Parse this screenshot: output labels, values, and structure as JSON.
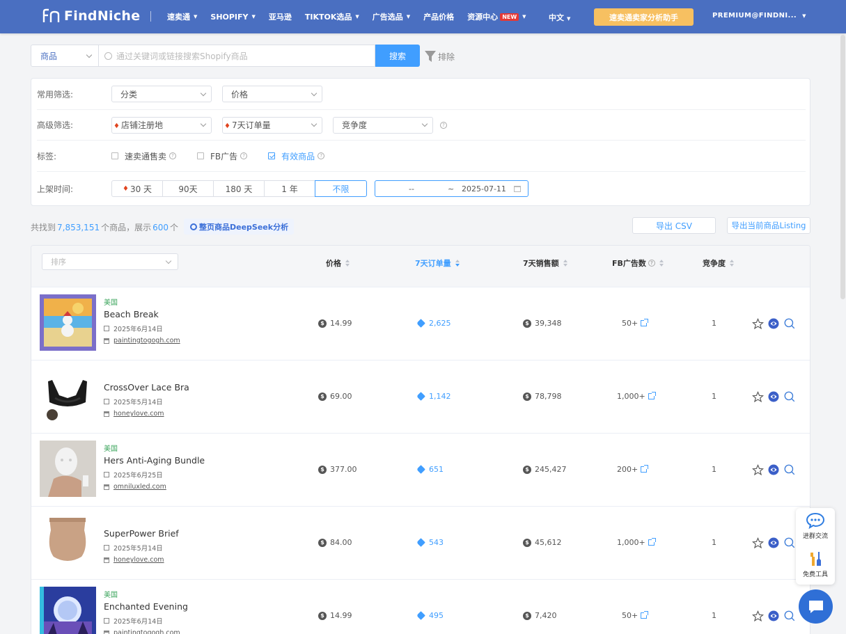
{
  "nav": {
    "logo": "FindNiche",
    "items": [
      {
        "label": "速卖通",
        "caret": true
      },
      {
        "label": "SHOPIFY",
        "caret": true
      },
      {
        "label": "亚马逊",
        "caret": false
      },
      {
        "label": "TIKTOK选品",
        "caret": true
      },
      {
        "label": "广告选品",
        "caret": true
      },
      {
        "label": "产品价格",
        "caret": false
      },
      {
        "label": "资源中心",
        "caret": true,
        "badge": "NEW"
      }
    ],
    "language": "中文",
    "promo_button": "速卖通卖家分析助手",
    "account": "PREMIUM@FINDNI..."
  },
  "search": {
    "type": "商品",
    "placeholder": "通过关键词或链接搜索Shopify商品",
    "button": "搜索",
    "exclude": "排除"
  },
  "filters": {
    "common_label": "常用筛选:",
    "category": "分类",
    "price": "价格",
    "advanced_label": "高级筛选:",
    "store_region": "店铺注册地",
    "orders_7d": "7天订单量",
    "competition": "竞争度",
    "tags_label": "标签:",
    "tags": [
      {
        "label": "速卖通售卖",
        "checked": false
      },
      {
        "label": "FB广告",
        "checked": false
      },
      {
        "label": "有效商品",
        "checked": true
      }
    ],
    "time_label": "上架时间:",
    "time_options": [
      "30 天",
      "90天",
      "180 天",
      "1 年",
      "不限"
    ],
    "time_active": "不限",
    "date_from": "--",
    "date_sep": "~",
    "date_to": "2025-07-11"
  },
  "summary": {
    "prefix": "共找到",
    "total": "7,853,151",
    "middle": "个商品，展示",
    "shown": "600",
    "suffix": "个",
    "deepseek": "整页商品DeepSeek分析",
    "export_csv": "导出 CSV",
    "export_listing": "导出当前商品Listing"
  },
  "table": {
    "sort_placeholder": "排序",
    "headers": {
      "price": "价格",
      "orders": "7天订单量",
      "sales": "7天销售额",
      "fb_ads": "FB广告数",
      "competition": "竞争度"
    },
    "rows": [
      {
        "country": "美国",
        "name": "Beach Break",
        "date": "2025年6月14日",
        "shop": "paintingtogogh.com",
        "price": "14.99",
        "orders": "2,625",
        "sales": "39,348",
        "ads": "50+",
        "competition": "1"
      },
      {
        "country": "",
        "name": "CrossOver Lace Bra",
        "date": "2025年5月14日",
        "shop": "honeylove.com",
        "price": "69.00",
        "orders": "1,142",
        "sales": "78,798",
        "ads": "1,000+",
        "competition": "1"
      },
      {
        "country": "美国",
        "name": "Hers Anti-Aging Bundle",
        "date": "2025年6月25日",
        "shop": "omniluxled.com",
        "price": "377.00",
        "orders": "651",
        "sales": "245,427",
        "ads": "200+",
        "competition": "1"
      },
      {
        "country": "",
        "name": "SuperPower Brief",
        "date": "2025年5月14日",
        "shop": "honeylove.com",
        "price": "84.00",
        "orders": "543",
        "sales": "45,612",
        "ads": "1,000+",
        "competition": "1"
      },
      {
        "country": "美国",
        "name": "Enchanted Evening",
        "date": "2025年6月14日",
        "shop": "paintingtogogh.com",
        "price": "14.99",
        "orders": "495",
        "sales": "7,420",
        "ads": "50+",
        "competition": "1"
      }
    ]
  },
  "side": {
    "group_chat": "进群交流",
    "free_tools": "免费工具"
  },
  "colors": {
    "nav": "#4a6fc1",
    "accent": "#409eff",
    "promo": "#f7c061",
    "badge": "#e53935"
  }
}
